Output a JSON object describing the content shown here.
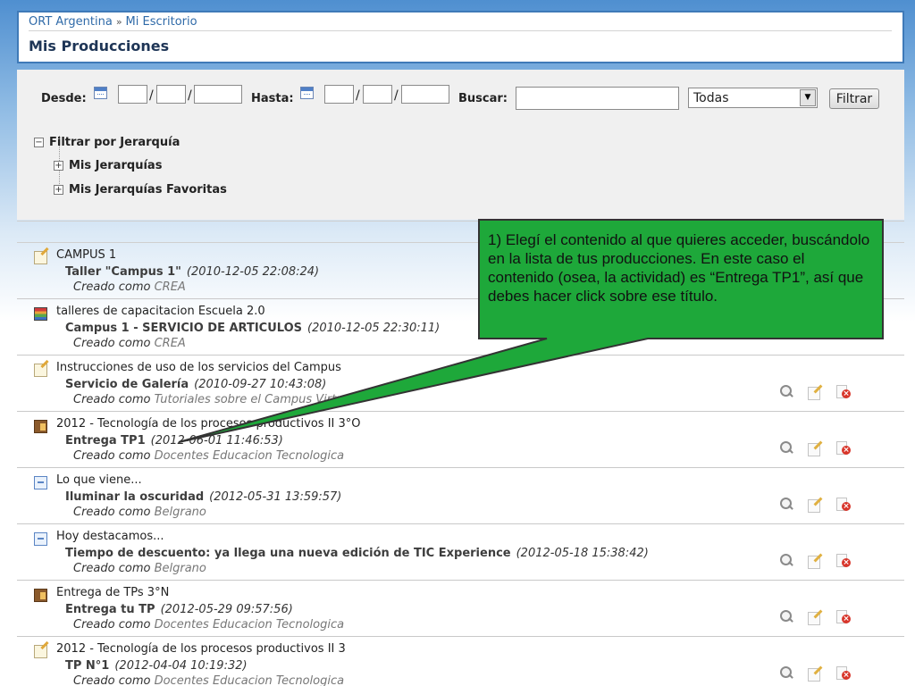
{
  "header": {
    "breadcrumb": [
      "ORT Argentina",
      "Mi Escritorio"
    ],
    "breadcrumb_separator": "»",
    "title": "Mis Producciones"
  },
  "filters": {
    "desde_label": "Desde:",
    "hasta_label": "Hasta:",
    "buscar_label": "Buscar:",
    "search_value": "",
    "date_separator": "/",
    "select_value": "Todas",
    "button_label": "Filtrar"
  },
  "tree": {
    "root": {
      "toggle": "−",
      "label": "Filtrar por Jerarquía"
    },
    "children": [
      {
        "toggle": "+",
        "label": "Mis Jerarquías"
      },
      {
        "toggle": "+",
        "label": "Mis Jerarquías Favoritas"
      }
    ]
  },
  "created_label": "Creado como",
  "productions": [
    {
      "icon": "note-icon",
      "group": "CAMPUS 1",
      "title": "Taller \"Campus 1\"",
      "date": "(2010-12-05 22:08:24)",
      "role": "CREA"
    },
    {
      "icon": "rainbow-icon",
      "group": "talleres de capacitacion Escuela 2.0",
      "title": "Campus 1 - SERVICIO DE ARTICULOS",
      "date": "(2010-12-05 22:30:11)",
      "role": "CREA"
    },
    {
      "icon": "note-icon",
      "group": "Instrucciones de uso de los servicios del Campus",
      "title": "Servicio de Galería",
      "date": "(2010-09-27 10:43:08)",
      "role": "Tutoriales sobre el Campus Virtual"
    },
    {
      "icon": "book-icon",
      "group": "2012 - Tecnología de los procesos productivos II 3°O",
      "title": "Entrega TP1",
      "date": "(2012-06-01 11:46:53)",
      "role": "Docentes Educacion Tecnologica"
    },
    {
      "icon": "blog-icon",
      "group": "Lo que viene...",
      "title": "Iluminar la oscuridad",
      "date": "(2012-05-31 13:59:57)",
      "role": "Belgrano"
    },
    {
      "icon": "blog-icon",
      "group": "Hoy destacamos...",
      "title": "Tiempo de descuento: ya llega una nueva edición de TIC Experience",
      "date": "(2012-05-18 15:38:42)",
      "role": "Belgrano"
    },
    {
      "icon": "book-icon",
      "group": "Entrega de TPs 3°N",
      "title": "Entrega tu TP",
      "date": "(2012-05-29 09:57:56)",
      "role": "Docentes Educacion Tecnologica"
    },
    {
      "icon": "note-icon",
      "group": "2012 - Tecnología de los procesos productivos II 3",
      "title": "TP N°1",
      "date": "(2012-04-04 10:19:32)",
      "role": "Docentes Educacion Tecnologica"
    }
  ],
  "callout": {
    "text": "1) Elegí el contenido al que quieres acceder, buscándolo en la lista de tus producciones. En este caso el contenido (osea, la actividad) es “Entrega TP1”, así que debes hacer click sobre ese título.",
    "fill": "#1ea83a",
    "border": "#333333"
  },
  "colors": {
    "link": "#2f6aa8",
    "title": "#1e3556",
    "panel": "#f0f0f0"
  }
}
